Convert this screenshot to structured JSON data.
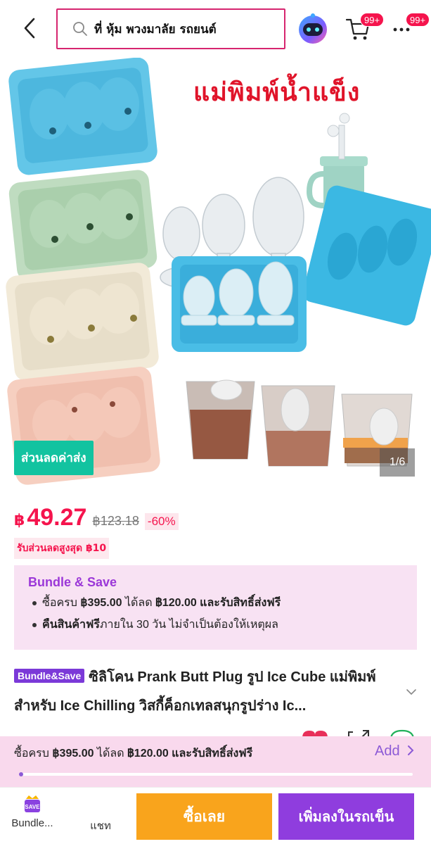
{
  "header": {
    "search_text": "ที่ หุ้ม พวงมาลัย รถยนต์",
    "cart_badge": "99+",
    "more_badge": "99+"
  },
  "gallery": {
    "image_title": "แม่พิมพ์น้ำแข็ง",
    "free_shipping_tag": "ส่วนลดค่าส่ง",
    "page_counter": "1/6"
  },
  "price": {
    "currency": "฿",
    "current": "49.27",
    "original": "฿123.18",
    "discount": "-60%",
    "voucher": "รับส่วนลดสูงสุด ฿10"
  },
  "bundle": {
    "title": "Bundle & Save",
    "line1_pre": "ซื้อครบ ",
    "line1_amount": "฿395.00",
    "line1_mid": " ได้ลด ",
    "line1_discount": "฿120.00",
    "line1_post": " และรับสิทธิ์ส่งฟรี",
    "line2_bold": "คืนสินค้าฟรี",
    "line2_rest": "ภายใน 30 วัน ไม่จำเป็นต้องให้เหตุผล"
  },
  "product": {
    "badge": "Bundle&Save",
    "title": "ซิลิโคน Prank Butt Plug รูป Ice Cube แม่พิมพ์สำหรับ Ice Chilling วิสกี้ค็อกเทลสนุกรูปร่าง Ic..."
  },
  "promo_bar": {
    "text_pre": "ซื้อครบ ",
    "amount": "฿395.00",
    "mid": " ได้ลด ",
    "discount": "฿120.00",
    "post": " และรับสิทธิ์ส่งฟรี",
    "add_label": "Add",
    "progress": 0.01
  },
  "bottom_bar": {
    "bundle_label": "Bundle...",
    "chat_label": "แชท",
    "buy_now": "ซื้อเลย",
    "add_to_cart": "เพิ่มลงในรถเข็น",
    "bundle_icon_text": "SAVE"
  },
  "colors": {
    "brand_pink": "#f5144d",
    "bundle_purple": "#8f3dde",
    "buy_orange": "#f9a41c",
    "teal_tag": "#12c3a0"
  }
}
